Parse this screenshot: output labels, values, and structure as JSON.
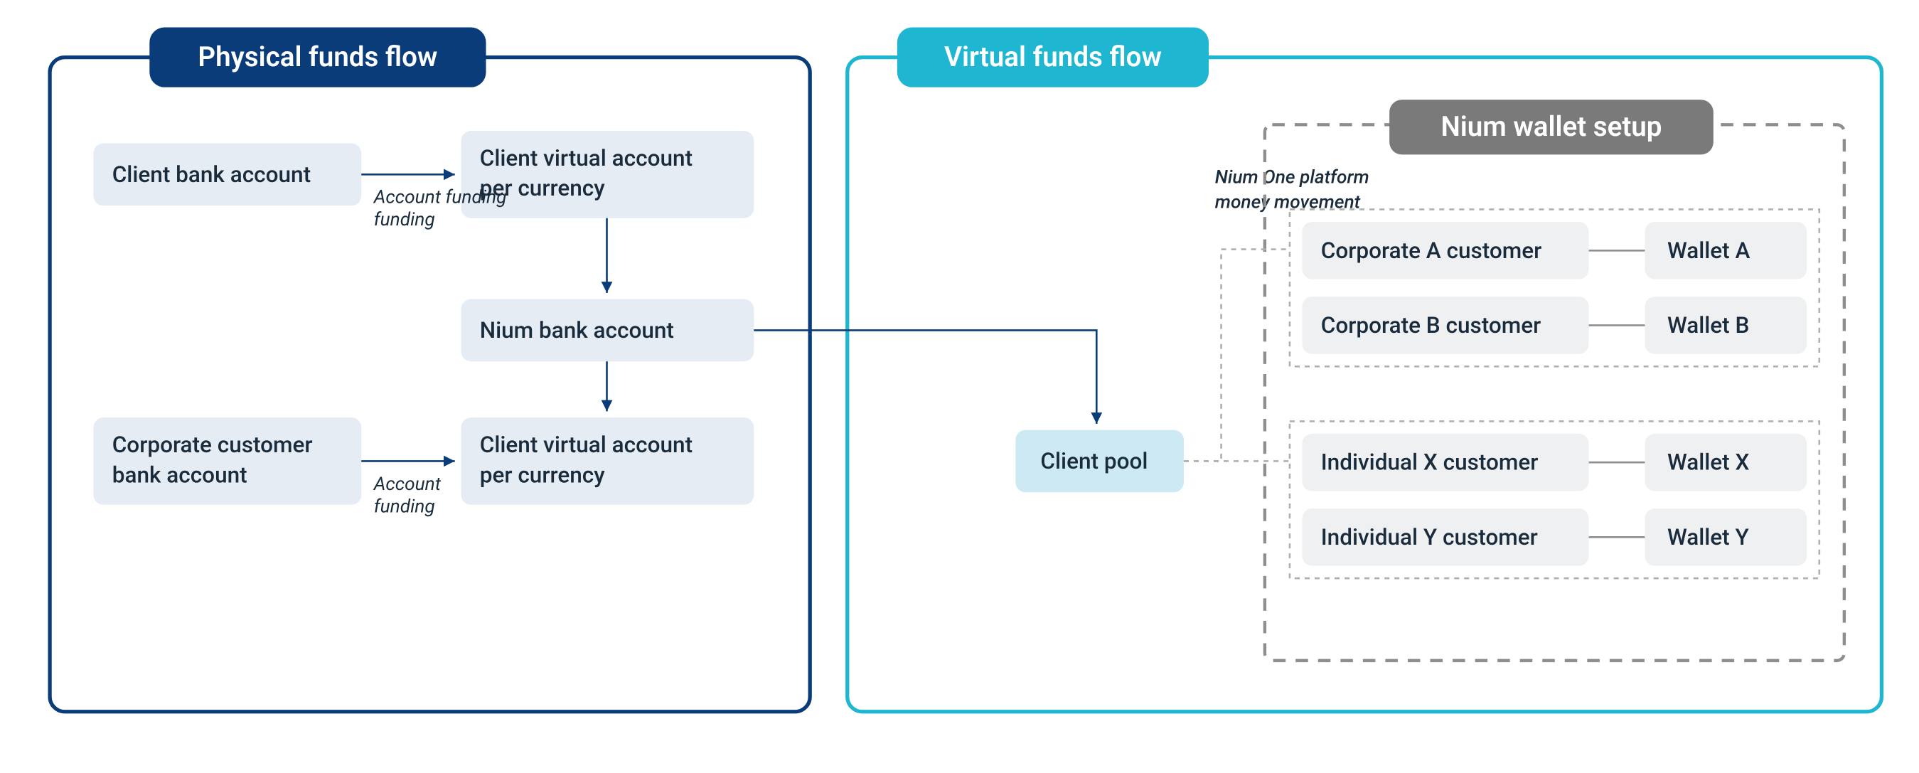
{
  "physical": {
    "title": "Physical funds flow",
    "client_bank": "Client bank account",
    "client_virtual_top": "Client virtual account per currency",
    "nium_bank": "Nium bank account",
    "client_virtual_bottom": "Client virtual account per currency",
    "corporate_bank_l1": "Corporate customer",
    "corporate_bank_l2": "bank account",
    "edge_label": "Account funding"
  },
  "virtual": {
    "title": "Virtual funds flow",
    "client_pool": "Client pool",
    "note_l1": "Nium One platform",
    "note_l2": "money movement",
    "wallet_setup_title": "Nium wallet setup",
    "rows": [
      {
        "customer": "Corporate A customer",
        "wallet": "Wallet A"
      },
      {
        "customer": "Corporate B customer",
        "wallet": "Wallet B"
      },
      {
        "customer": "Individual X customer",
        "wallet": "Wallet X"
      },
      {
        "customer": "Individual Y customer",
        "wallet": "Wallet Y"
      }
    ]
  },
  "colors": {
    "darkblue": "#0b3c7a",
    "cyan": "#1fb6d1",
    "boxfill": "#e5ecf4",
    "poolfill": "#cdeaf4",
    "walletbox": "#eef0f2",
    "grey": "#8e8e8e",
    "greyfill": "#7a7a7a",
    "arrow": "#0b3c7a"
  }
}
